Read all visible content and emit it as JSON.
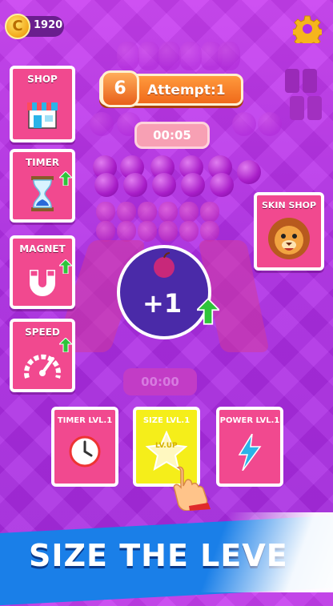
{
  "hud": {
    "coin_symbol": "C",
    "coins": "1920",
    "settings_icon": "gear-icon"
  },
  "attempt": {
    "level": "6",
    "label": "Attempt:1"
  },
  "timers": {
    "top": "00:05",
    "bottom": "00:00"
  },
  "side_powerups": [
    {
      "label": "SHOP",
      "icon": "shop-icon"
    },
    {
      "label": "TIMER",
      "icon": "hourglass-icon"
    },
    {
      "label": "MAGNET",
      "icon": "magnet-icon"
    },
    {
      "label": "SPEED",
      "icon": "speedometer-icon"
    }
  ],
  "skin_shop": {
    "label": "SKIN SHOP",
    "icon": "lion-icon"
  },
  "center_bonus": {
    "text": "+1",
    "icon": "apple-icon"
  },
  "upgrades": [
    {
      "label": "TIMER LVL.1",
      "icon": "clock-icon",
      "color": "#f1498f"
    },
    {
      "label": "SIZE LVL.1",
      "icon": "star-icon",
      "badge": "LV.UP",
      "color": "#f5ee1a"
    },
    {
      "label": "POWER LVL.1",
      "icon": "lightning-icon",
      "color": "#f1498f"
    }
  ],
  "banner": {
    "text": "SIZE THE LEVE"
  },
  "colors": {
    "background": "#b02ee6",
    "accent": "#f1498f",
    "banner": "#1a7fe8",
    "attempt": "#f06a1a"
  }
}
